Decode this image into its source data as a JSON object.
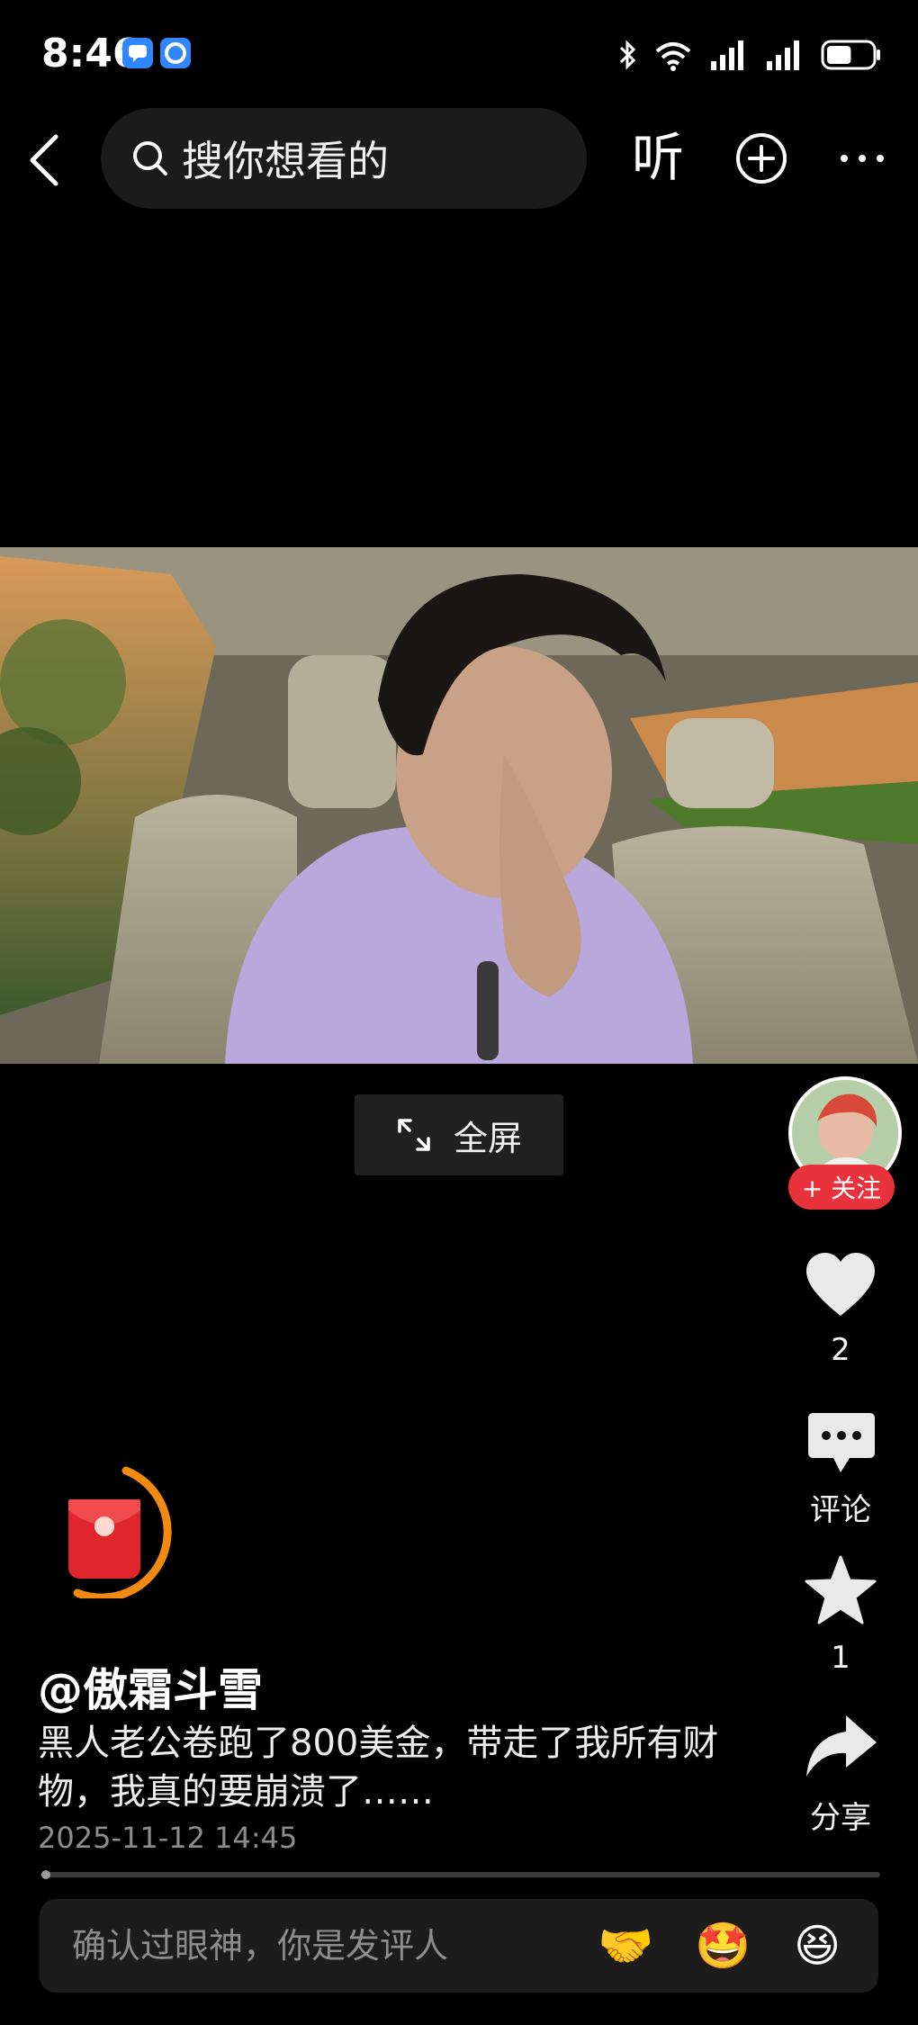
{
  "status_bar": {
    "time": "8:46",
    "icons": [
      "message-app-icon",
      "app-icon",
      "bluetooth-icon",
      "wifi-icon",
      "signal-icon",
      "signal-icon",
      "battery-icon"
    ],
    "battery_level": 0.55
  },
  "top_bar": {
    "back_icon": "back-arrow-icon",
    "search_placeholder": "搜你想看的",
    "listen_label": "听",
    "add_icon": "plus-circle-icon",
    "more_icon": "more-icon"
  },
  "video": {
    "fullscreen_label": "全屏",
    "progress": 0.01
  },
  "right_rail": {
    "follow_label": "+ 关注",
    "like_count": "2",
    "comment_label": "评论",
    "favorite_count": "1",
    "share_label": "分享"
  },
  "post": {
    "author": "@傲霜斗雪",
    "description": "黑人老公卷跑了800美金，带走了我所有财物，我真的要崩溃了……",
    "date": "2025-11-12 14:45"
  },
  "comment_bar": {
    "placeholder": "确认过眼神，你是发评人",
    "emojis": [
      "🤝",
      "🤩",
      "😆"
    ]
  },
  "colors": {
    "background": "#000000",
    "follow_red": "#e8323c",
    "redpacket_ring": "#f28a0f"
  }
}
